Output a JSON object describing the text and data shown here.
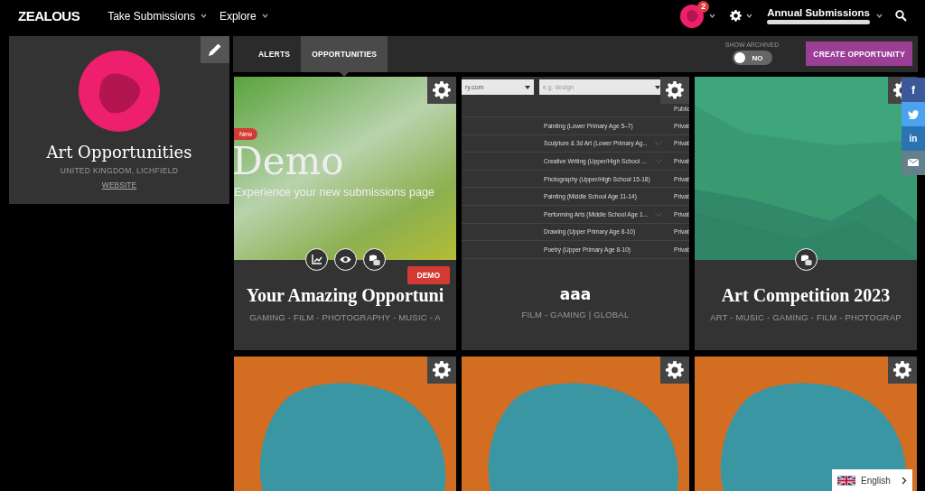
{
  "nav": {
    "logo": "ZEALOUS",
    "menus": [
      {
        "label": "Take Submissions"
      },
      {
        "label": "Explore"
      }
    ],
    "notification_count": "2",
    "account": "Annual Submissions"
  },
  "profile": {
    "name": "Art Opportunities",
    "location": "UNITED KINGDOM, LICHFIELD",
    "website": "WEBSITE"
  },
  "tabs": [
    {
      "label": "ALERTS",
      "selected": false
    },
    {
      "label": "OPPORTUNITIES",
      "selected": true
    }
  ],
  "archived_toggle": {
    "label": "SHOW ARCHIVED",
    "on": false,
    "state_text": "NO"
  },
  "create_button": "CREATE OPPORTUNITY",
  "cards": [
    {
      "preview": {
        "kind": "demo",
        "badge": "New",
        "heading": "Demo",
        "tagline": "Experience your new submissions page"
      },
      "actions": [
        {
          "kind": "stats"
        },
        {
          "kind": "preview"
        },
        {
          "kind": "payments"
        }
      ],
      "status_badge": "DEMO",
      "title": "Your Amazing Opportuni",
      "tags": "GAMING - FILM - PHOTOGRAPHY - MUSIC - A"
    },
    {
      "preview": {
        "kind": "table",
        "fields": [
          {
            "value": "ry.com"
          },
          {
            "placeholder": "e.g. design"
          }
        ],
        "rows": [
          {
            "visibility": "Public"
          },
          {
            "category": "Painting (Lower Primary Age 5–7)",
            "visibility": "Privat",
            "expandable": false
          },
          {
            "category": "Sculpture & 3d Art (Lower Primary Ag...",
            "visibility": "Privat",
            "expandable": true
          },
          {
            "category": "Creative Writing (Upper/High School ...",
            "visibility": "Privat",
            "expandable": true
          },
          {
            "category": "Photography (Upper/High School 15-18)",
            "visibility": "Privat",
            "expandable": false
          },
          {
            "category": "Painting (Middle School Age 11-14)",
            "visibility": "Privat",
            "expandable": false
          },
          {
            "category": "Performing Arts (Middle School Age 1...",
            "visibility": "Privat",
            "expandable": true
          },
          {
            "category": "Drawing (Upper Primary Age 8-10)",
            "visibility": "Privat",
            "expandable": false
          },
          {
            "category": "Poetry (Upper Primary Age 8-10)",
            "visibility": "Privat",
            "expandable": false
          }
        ]
      },
      "title": "aaa",
      "tags": "FILM - GAMING | GLOBAL"
    },
    {
      "preview": {
        "kind": "picture"
      },
      "actions": [
        {
          "kind": "payments"
        }
      ],
      "title": "Art Competition 2023",
      "tags": "ART - MUSIC - GAMING - FILM - PHOTOGRAP"
    },
    {
      "preview": {
        "kind": "picture"
      }
    },
    {
      "preview": {
        "kind": "picture"
      }
    },
    {
      "preview": {
        "kind": "picture"
      }
    }
  ],
  "share": [
    {
      "kind": "facebook",
      "label": "f"
    },
    {
      "kind": "twitter"
    },
    {
      "kind": "linkedin",
      "label": "in"
    },
    {
      "kind": "email"
    }
  ],
  "language": "English"
}
